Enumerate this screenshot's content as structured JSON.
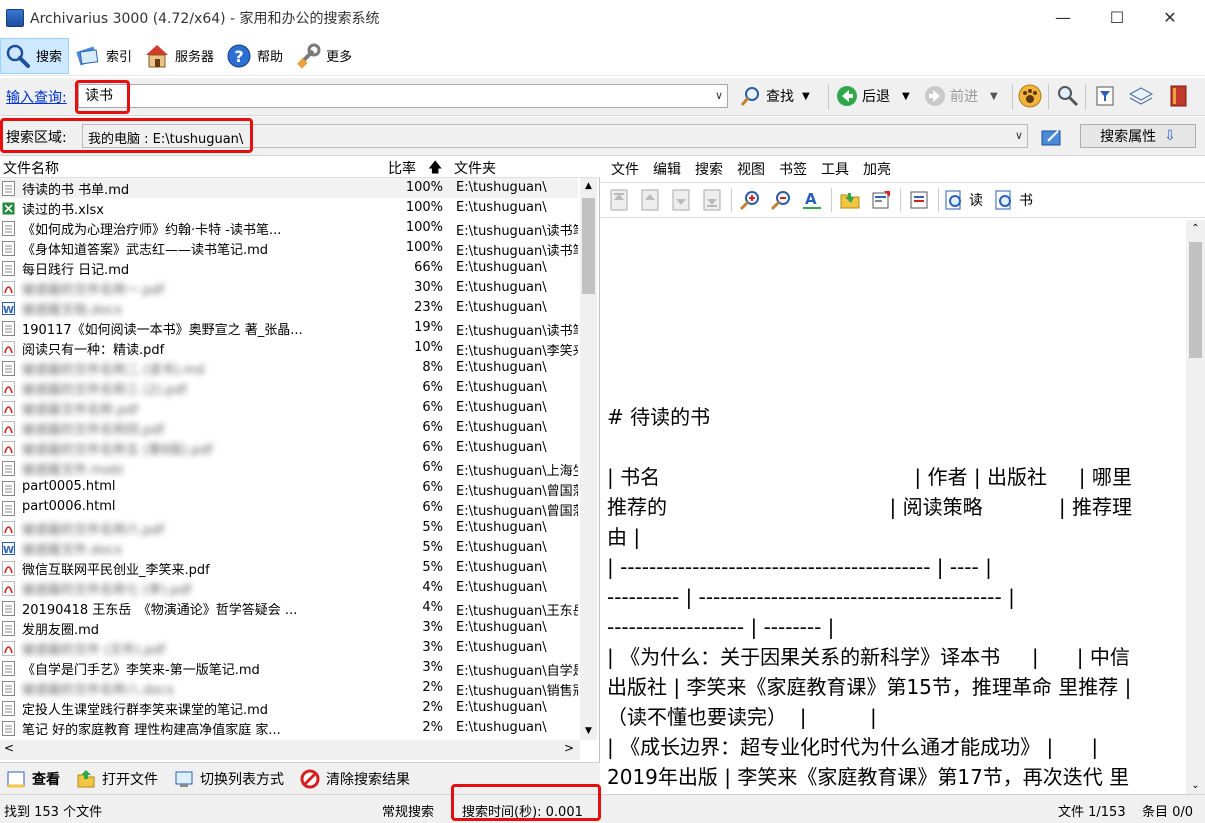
{
  "window": {
    "title": "Archivarius 3000 (4.72/x64) - 家用和办公的搜索系统",
    "min": "—",
    "max": "☐",
    "close": "✕"
  },
  "menubar": [
    {
      "label": "搜索",
      "icon": "search-icon"
    },
    {
      "label": "索引",
      "icon": "index-icon"
    },
    {
      "label": "服务器",
      "icon": "server-icon"
    },
    {
      "label": "帮助",
      "icon": "help-icon"
    },
    {
      "label": "更多",
      "icon": "tools-icon"
    }
  ],
  "query": {
    "label": "输入查询:",
    "value": "读书",
    "find_label": "查找",
    "back_label": "后退",
    "forward_label": "前进"
  },
  "area": {
    "label": "搜索区域:",
    "value": "我的电脑 : E:\\tushuguan\\",
    "props_label": "搜索属性"
  },
  "results": {
    "headers": {
      "name": "文件名称",
      "ratio": "比率",
      "folder": "文件夹"
    },
    "rows": [
      {
        "name": "待读的书 书单.md",
        "ratio": "100%",
        "folder": "E:\\tushuguan\\",
        "type": "md"
      },
      {
        "name": "读过的书.xlsx",
        "ratio": "100%",
        "folder": "E:\\tushuguan\\",
        "type": "xlsx"
      },
      {
        "name": "《如何成为心理治疗师》约翰·卡特 -读书笔...",
        "ratio": "100%",
        "folder": "E:\\tushuguan\\读书笔",
        "type": "md"
      },
      {
        "name": "《身体知道答案》武志红——读书笔记.md",
        "ratio": "100%",
        "folder": "E:\\tushuguan\\读书笔",
        "type": "md"
      },
      {
        "name": "每日践行 日记.md",
        "ratio": "66%",
        "folder": "E:\\tushuguan\\",
        "type": "md"
      },
      {
        "name": "被遮蔽的文件名称一.pdf",
        "ratio": "30%",
        "folder": "E:\\tushuguan\\",
        "type": "pdf",
        "blur": true
      },
      {
        "name": "被遮蔽文档.docx",
        "ratio": "23%",
        "folder": "E:\\tushuguan\\",
        "type": "doc",
        "blur": true
      },
      {
        "name": "190117《如何阅读一本书》奥野宣之 著_张晶...",
        "ratio": "19%",
        "folder": "E:\\tushuguan\\读书笔",
        "type": "md"
      },
      {
        "name": "阅读只有一种：精读.pdf",
        "ratio": "10%",
        "folder": "E:\\tushuguan\\李笑来",
        "type": "pdf"
      },
      {
        "name": "被遮蔽的文件名称二 (读书).md",
        "ratio": "8%",
        "folder": "E:\\tushuguan\\",
        "type": "md",
        "blur": true
      },
      {
        "name": "被遮蔽的文件名称三 (2).pdf",
        "ratio": "6%",
        "folder": "E:\\tushuguan\\",
        "type": "pdf",
        "blur": true
      },
      {
        "name": "被遮蔽文件名称.pdf",
        "ratio": "6%",
        "folder": "E:\\tushuguan\\",
        "type": "pdf",
        "blur": true
      },
      {
        "name": "被遮蔽的文件名称四.pdf",
        "ratio": "6%",
        "folder": "E:\\tushuguan\\",
        "type": "pdf",
        "blur": true
      },
      {
        "name": "被遮蔽的文件名称五 (第8版).pdf",
        "ratio": "6%",
        "folder": "E:\\tushuguan\\",
        "type": "pdf",
        "blur": true
      },
      {
        "name": "被遮蔽文件.mobi",
        "ratio": "6%",
        "folder": "E:\\tushuguan\\上海生",
        "type": "md",
        "blur": true
      },
      {
        "name": "part0005.html",
        "ratio": "6%",
        "folder": "E:\\tushuguan\\曾国藩",
        "type": "md"
      },
      {
        "name": "part0006.html",
        "ratio": "6%",
        "folder": "E:\\tushuguan\\曾国藩",
        "type": "md"
      },
      {
        "name": "被遮蔽的文件名称六.pdf",
        "ratio": "5%",
        "folder": "E:\\tushuguan\\",
        "type": "pdf",
        "blur": true
      },
      {
        "name": "被遮蔽文件.docx",
        "ratio": "5%",
        "folder": "E:\\tushuguan\\",
        "type": "doc",
        "blur": true
      },
      {
        "name": "微信互联网平民创业_李笑来.pdf",
        "ratio": "5%",
        "folder": "E:\\tushuguan\\",
        "type": "pdf"
      },
      {
        "name": "被遮蔽的文件名称七 (李).pdf",
        "ratio": "4%",
        "folder": "E:\\tushuguan\\",
        "type": "pdf",
        "blur": true
      },
      {
        "name": "20190418 王东岳　《物演通论》哲学答疑会 ...",
        "ratio": "4%",
        "folder": "E:\\tushuguan\\王东岳",
        "type": "md"
      },
      {
        "name": "发朋友圈.md",
        "ratio": "3%",
        "folder": "E:\\tushuguan\\",
        "type": "md"
      },
      {
        "name": "被遮蔽的文件 (文件).pdf",
        "ratio": "3%",
        "folder": "E:\\tushuguan\\",
        "type": "pdf",
        "blur": true
      },
      {
        "name": "《自学是门手艺》李笑来-第一版笔记.md",
        "ratio": "3%",
        "folder": "E:\\tushuguan\\自学是",
        "type": "md"
      },
      {
        "name": "被遮蔽的文件名称八.docx",
        "ratio": "2%",
        "folder": "E:\\tushuguan\\销售冠",
        "type": "md",
        "blur": true
      },
      {
        "name": "定投人生课堂践行群李笑来课堂的笔记.md",
        "ratio": "2%",
        "folder": "E:\\tushuguan\\",
        "type": "md"
      },
      {
        "name": "笔记 好的家庭教育 理性构建高净值家庭 家...",
        "ratio": "2%",
        "folder": "E:\\tushuguan\\",
        "type": "md"
      }
    ]
  },
  "viewer": {
    "menu": [
      "文件",
      "编辑",
      "搜索",
      "视图",
      "书签",
      "工具",
      "加亮"
    ],
    "read_label": "读",
    "book_label": "书",
    "lines": [
      "# 待读的书",
      "",
      "| 书名                                        | 作者 | 出版社     | 哪里",
      "推荐的                                   | 阅读策略            | 推荐理",
      "由 |",
      "| ------------------------------------------- | ---- |",
      "---------- | ------------------------------------------ |",
      "------------------- | -------- |",
      "| 《为什么：关于因果关系的新科学》译本书     |      | 中信",
      "出版社 | 李笑来《家庭教育课》第15节，推理革命 里推荐 |",
      "（读不懂也要读完）  |          |",
      "| 《成长边界：超专业化时代为什么通才能成功》 |      |",
      "2019年出版 | 李笑来《家庭教育课》第17节，再次迭代 里"
    ]
  },
  "actions": {
    "view_label": "查看",
    "open_label": "打开文件",
    "switch_label": "切换列表方式",
    "clear_label": "清除搜索结果"
  },
  "status": {
    "found": "找到 153 个文件",
    "mode": "常规搜索",
    "time": "搜索时间(秒): 0.001",
    "file_pos": "文件 1/153",
    "entry_pos": "条目 0/0"
  },
  "colors": {
    "highlight_border": "#e41010",
    "link": "#0033cc",
    "pdf": "#d42020",
    "xlsx": "#1f8a3a",
    "doc": "#2b5fb8"
  }
}
